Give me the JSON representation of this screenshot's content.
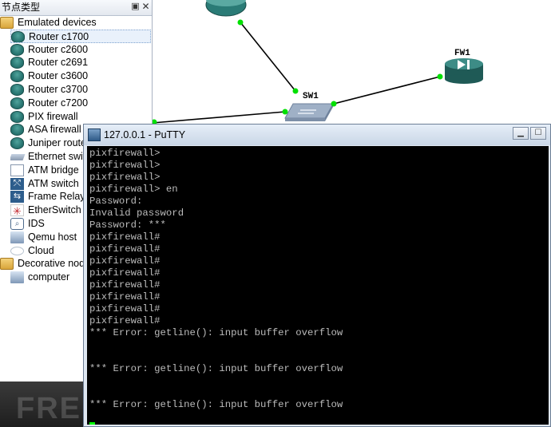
{
  "panel": {
    "title": "节点类型",
    "float_icon": "restore-icon",
    "close_icon": "close-icon",
    "items": [
      {
        "label": "Emulated devices",
        "icon": "folder-icon",
        "level": 0
      },
      {
        "label": "Router c1700",
        "icon": "router-icon",
        "level": 1,
        "selected": true
      },
      {
        "label": "Router c2600",
        "icon": "router-icon",
        "level": 1
      },
      {
        "label": "Router c2691",
        "icon": "router-icon",
        "level": 1
      },
      {
        "label": "Router c3600",
        "icon": "router-icon",
        "level": 1
      },
      {
        "label": "Router c3700",
        "icon": "router-icon",
        "level": 1
      },
      {
        "label": "Router c7200",
        "icon": "router-icon",
        "level": 1
      },
      {
        "label": "PIX firewall",
        "icon": "firewall-icon",
        "level": 1
      },
      {
        "label": "ASA firewall",
        "icon": "firewall-icon",
        "level": 1
      },
      {
        "label": "Juniper router",
        "icon": "router-icon",
        "level": 1
      },
      {
        "label": "Ethernet switch",
        "icon": "switch-icon",
        "level": 1
      },
      {
        "label": "ATM bridge",
        "icon": "atm-bridge-icon",
        "level": 1
      },
      {
        "label": "ATM switch",
        "icon": "atm-switch-icon",
        "level": 1
      },
      {
        "label": "Frame Relay switch",
        "icon": "frame-relay-icon",
        "level": 1
      },
      {
        "label": "EtherSwitch router",
        "icon": "etherswitch-icon",
        "level": 1
      },
      {
        "label": "IDS",
        "icon": "ids-icon",
        "level": 1
      },
      {
        "label": "Qemu host",
        "icon": "host-icon",
        "level": 1
      },
      {
        "label": "Cloud",
        "icon": "cloud-icon",
        "level": 1
      },
      {
        "label": "Decorative nodes",
        "icon": "folder-icon",
        "level": 0
      },
      {
        "label": "computer",
        "icon": "host-icon",
        "level": 1
      }
    ]
  },
  "topology": {
    "nodes": [
      {
        "label": "SW1",
        "type": "switch"
      },
      {
        "label": "FW1",
        "type": "firewall"
      },
      {
        "label": "",
        "type": "router"
      }
    ],
    "link_color": "#000000",
    "port_color": "#00e000"
  },
  "putty": {
    "title": "127.0.0.1 - PuTTY",
    "minimize_icon": "minimize-icon",
    "maximize_icon": "maximize-icon",
    "terminal_lines": [
      "pixfirewall>",
      "pixfirewall>",
      "pixfirewall>",
      "pixfirewall> en",
      "Password:",
      "Invalid password",
      "Password: ***",
      "pixfirewall#",
      "pixfirewall#",
      "pixfirewall#",
      "pixfirewall#",
      "pixfirewall#",
      "pixfirewall#",
      "pixfirewall#",
      "pixfirewall#",
      "*** Error: getline(): input buffer overflow",
      "",
      "",
      "*** Error: getline(): input buffer overflow",
      "",
      "",
      "*** Error: getline(): input buffer overflow"
    ],
    "colors": {
      "background": "#000000",
      "text": "#bbbbbb",
      "cursor": "#00ff00"
    }
  },
  "watermark": "FREEBUF"
}
